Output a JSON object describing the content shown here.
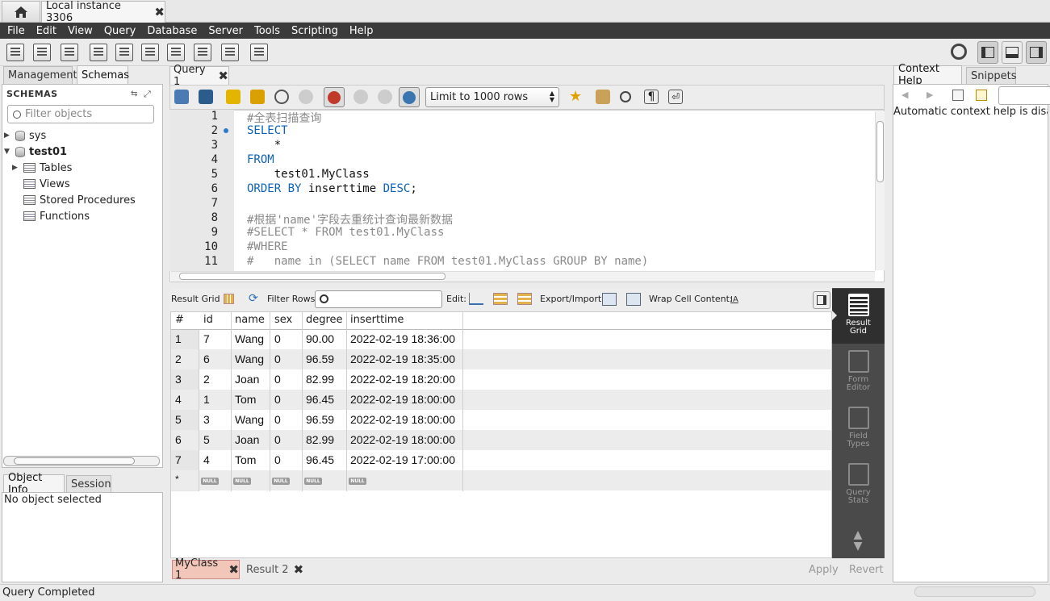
{
  "title_tabs": {
    "home": "home-icon",
    "connection": "Local instance 3306"
  },
  "menu": [
    "File",
    "Edit",
    "View",
    "Query",
    "Database",
    "Server",
    "Tools",
    "Scripting",
    "Help"
  ],
  "left": {
    "tabs": [
      "Management",
      "Schemas"
    ],
    "header": "SCHEMAS",
    "filter_placeholder": "Filter objects",
    "tree": {
      "sys": "sys",
      "test01": "test01",
      "tables": "Tables",
      "views": "Views",
      "procs": "Stored Procedures",
      "funcs": "Functions"
    },
    "bottom_tabs": [
      "Object Info",
      "Session"
    ],
    "object_info": "No object selected"
  },
  "editor": {
    "tab": "Query 1",
    "limit": "Limit to 1000 rows",
    "line_numbers": [
      "1",
      "2",
      "3",
      "4",
      "5",
      "6",
      "7",
      "8",
      "9",
      "10",
      "11"
    ],
    "lines": {
      "l1": "#全表扫描查询",
      "l2": "SELECT",
      "l3": "    *",
      "l4": "FROM",
      "l5": "    test01.MyClass",
      "l6a": "ORDER BY",
      "l6b": " inserttime ",
      "l6c": "DESC",
      "l6d": ";",
      "l8": "#根据'name'字段去重统计查询最新数据",
      "l9": "#SELECT * FROM test01.MyClass",
      "l10": "#WHERE",
      "l11": "#   name in (SELECT name FROM test01.MyClass GROUP BY name)"
    }
  },
  "results": {
    "toolbar": {
      "result_grid": "Result Grid",
      "filter_rows": "Filter Rows:",
      "edit": "Edit:",
      "export_import": "Export/Import:",
      "wrap": "Wrap Cell Content:"
    },
    "columns": [
      "#",
      "id",
      "name",
      "sex",
      "degree",
      "inserttime"
    ],
    "rows": [
      [
        "1",
        "7",
        "Wang",
        "0",
        "90.00",
        "2022-02-19 18:36:00"
      ],
      [
        "2",
        "6",
        "Wang",
        "0",
        "96.59",
        "2022-02-19 18:35:00"
      ],
      [
        "3",
        "2",
        "Joan",
        "0",
        "82.99",
        "2022-02-19 18:20:00"
      ],
      [
        "4",
        "1",
        "Tom",
        "0",
        "96.45",
        "2022-02-19 18:00:00"
      ],
      [
        "5",
        "3",
        "Wang",
        "0",
        "96.59",
        "2022-02-19 18:00:00"
      ],
      [
        "6",
        "5",
        "Joan",
        "0",
        "82.99",
        "2022-02-19 18:00:00"
      ],
      [
        "7",
        "4",
        "Tom",
        "0",
        "96.45",
        "2022-02-19 17:00:00"
      ]
    ],
    "new_row_marker": "*",
    "null_label": "NULL",
    "side": [
      {
        "line1": "Result",
        "line2": "Grid"
      },
      {
        "line1": "Form",
        "line2": "Editor"
      },
      {
        "line1": "Field",
        "line2": "Types"
      },
      {
        "line1": "Query",
        "line2": "Stats"
      }
    ],
    "tabs": [
      "MyClass 1",
      "Result 2"
    ],
    "apply": "Apply",
    "revert": "Revert"
  },
  "right": {
    "tabs": [
      "Context Help",
      "Snippets"
    ],
    "text": "Automatic context help is disab"
  },
  "status": "Query Completed"
}
